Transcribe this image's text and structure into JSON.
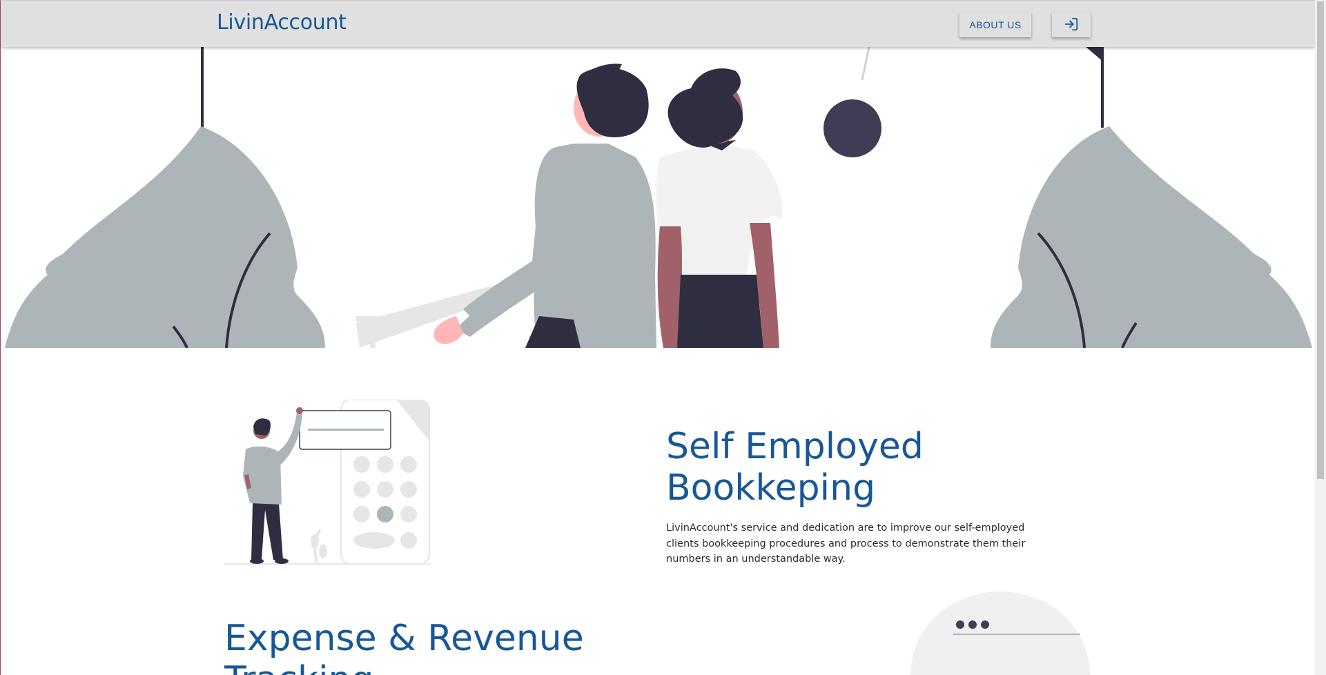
{
  "navbar": {
    "brand": "LivinAccount",
    "about_label": "ABOUT US",
    "login_icon": "login-icon"
  },
  "features": [
    {
      "title": "Self Employed Bookkeping",
      "text": "LivinAccount's service and dedication are to improve our self-employed clients bookkeeping procedures and process to demonstrate them their numbers in an understandable way.",
      "illustration_icon": "calculator-illustration"
    },
    {
      "title": "Expense & Revenue Tracking",
      "illustration_icon": "browser-window-illustration"
    }
  ],
  "colors": {
    "brand": "#175797",
    "navbar_bg": "#e0e0e0",
    "illustration_dark": "#2f2e41",
    "illustration_grey": "#adb5b9",
    "skin_pink": "#ffb6b6",
    "skin_dark": "#a0616a"
  }
}
